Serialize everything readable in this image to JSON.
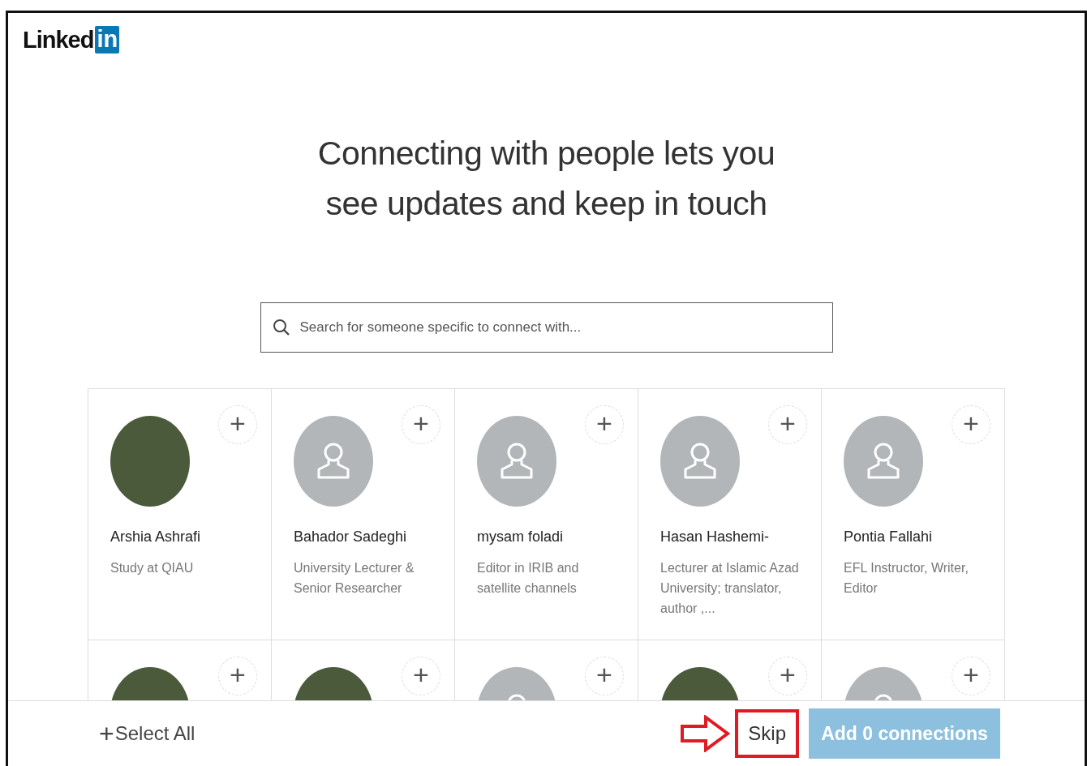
{
  "logo": {
    "word": "Linked",
    "badge": "in"
  },
  "headline": {
    "line_1": "Connecting with people lets you",
    "line_2": "see updates and keep in touch"
  },
  "search": {
    "placeholder": "Search for someone specific to connect with..."
  },
  "people": [
    {
      "kind": "photo",
      "name": "Arshia Ashrafi",
      "headline": "Study at QIAU"
    },
    {
      "kind": "placeholder",
      "name": "Bahador Sadeghi",
      "headline": "University Lecturer & Senior Researcher"
    },
    {
      "kind": "placeholder",
      "name": "mysam foladi",
      "headline": "Editor in IRIB and satellite channels"
    },
    {
      "kind": "placeholder",
      "name": "Hasan Hashemi-",
      "headline": "Lecturer at Islamic Azad University; translator, author ,..."
    },
    {
      "kind": "placeholder",
      "name": "Pontia Fallahi",
      "headline": "EFL Instructor, Writer, Editor"
    },
    {
      "kind": "photo"
    },
    {
      "kind": "photo"
    },
    {
      "kind": "placeholder"
    },
    {
      "kind": "photo"
    },
    {
      "kind": "placeholder"
    }
  ],
  "footer": {
    "select_all": {
      "icon": "+",
      "label": "Select All"
    },
    "skip": {
      "label": "Skip",
      "highlighted": true
    },
    "add": {
      "label": "Add 0 connections",
      "disabled": true
    }
  }
}
